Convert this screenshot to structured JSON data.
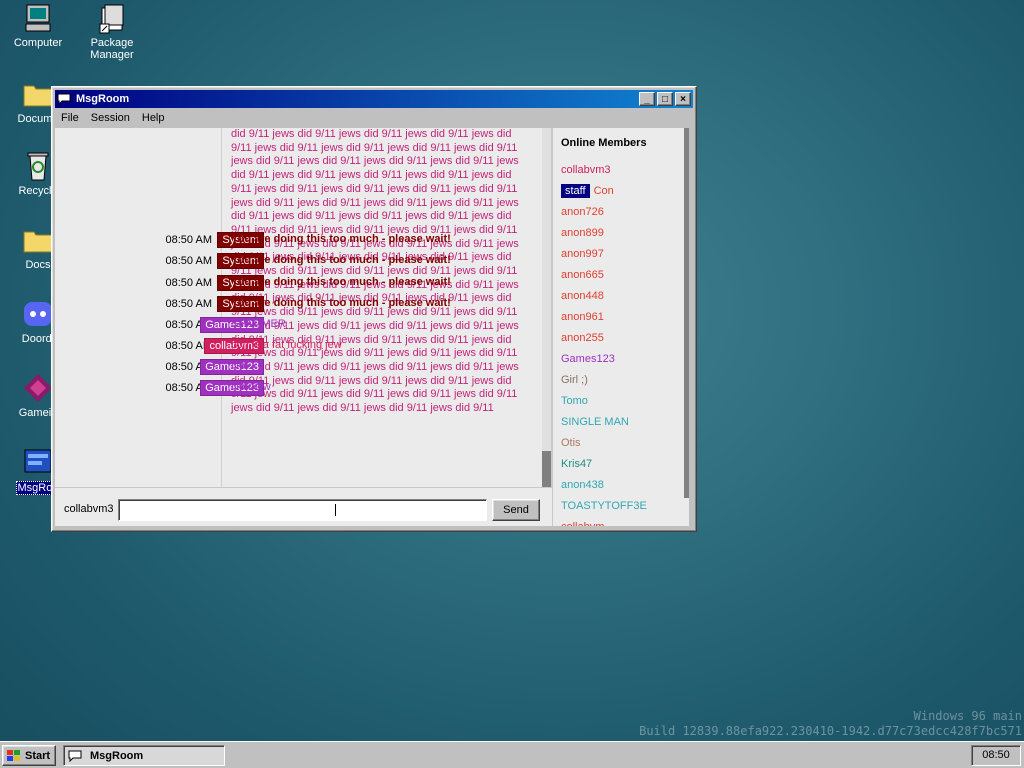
{
  "desktop": {
    "icons": [
      {
        "label": "Computer"
      },
      {
        "label": "Package Manager"
      },
      {
        "label": "Docume"
      },
      {
        "label": "Recycle"
      },
      {
        "label": "Docs"
      },
      {
        "label": "Doordi"
      },
      {
        "label": "Gamein"
      },
      {
        "label": "MsgRoo"
      }
    ],
    "watermark": {
      "line1": "Windows 96 main",
      "line2": "Build 12839.88efa922.230410-1942.d77c73edcc428f7bc571"
    }
  },
  "window": {
    "title": "MsgRoom",
    "menu": [
      "File",
      "Session",
      "Help"
    ],
    "spam_text": "did 9/11 jews did 9/11 jews did 9/11 jews did 9/11 jews did 9/11 jews did 9/11 jews did 9/11 jews did 9/11 jews did 9/11 jews did 9/11 jews did 9/11 jews did 9/11 jews did 9/11 jews did 9/11 jews did 9/11 jews did 9/11 jews did 9/11 jews did 9/11 jews did 9/11 jews did 9/11 jews did 9/11 jews did 9/11 jews did 9/11 jews did 9/11 jews did 9/11 jews did 9/11 jews did 9/11 jews did 9/11 jews did 9/11 jews did 9/11 jews did 9/11 jews did 9/11 jews did 9/11 jews did 9/11 jews did 9/11 jews did 9/11 jews did 9/11 jews did 9/11 jews did 9/11 jews did 9/11 jews did 9/11 jews did 9/11 jews did 9/11 jews did 9/11 jews did 9/11 jews did 9/11 jews did 9/11 jews did 9/11 jews did 9/11 jews did 9/11 jews did 9/11 jews did 9/11 jews did 9/11 jews did 9/11 jews did 9/11 jews did 9/11 jews did 9/11 jews did 9/11 jews did 9/11 jews did 9/11 jews did 9/11 jews did 9/11 jews did 9/11 jews did 9/11 jews did 9/11 jews did 9/11 jews did 9/11 jews did 9/11 jews did 9/11 jews did 9/11 jews did 9/11 jews did 9/11 jews did 9/11 jews did 9/11 jews did 9/11 jews did 9/11 jews did 9/11 jews did 9/11 jews did 9/11 jews did 9/11 jews did 9/11 jews did 9/11 jews did 9/11 jews did 9/11 jews did 9/11 jews did 9/11 jews did 9/11 jews did 9/11 jews did 9/11 jews did 9/11 jews did 9/11",
    "messages": [
      {
        "time": "08:50 AM",
        "user": "System",
        "color": "#800000",
        "text": "You are doing this too much - please wait!",
        "bold": true
      },
      {
        "time": "08:50 AM",
        "user": "System",
        "color": "#800000",
        "text": "You are doing this too much - please wait!",
        "bold": true
      },
      {
        "time": "08:50 AM",
        "user": "System",
        "color": "#800000",
        "text": "You are doing this too much - please wait!",
        "bold": true
      },
      {
        "time": "08:50 AM",
        "user": "System",
        "color": "#800000",
        "text": "You are doing this too much - please wait!",
        "bold": true
      },
      {
        "time": "08:50 AM",
        "user": "Games123",
        "color": "#a030c0",
        "text": "SPAMMER",
        "bold": false
      },
      {
        "time": "08:50 AM",
        "user": "collabvm3",
        "color": "#d02060",
        "text": "con is a fat fucking jew",
        "bold": false
      },
      {
        "time": "08:50 AM",
        "user": "Games123",
        "color": "#a030c0",
        "text": "No",
        "bold": false
      },
      {
        "time": "08:50 AM",
        "user": "Games123",
        "color": "#a030c0",
        "text": "No nsfw",
        "bold": false
      }
    ],
    "input": {
      "nick": "collabvm3",
      "value": "",
      "send_label": "Send"
    },
    "members": {
      "title": "Online Members",
      "staff_badge": "staff",
      "list": [
        {
          "name": "collabvm3",
          "color": "#d02060",
          "staff": false
        },
        {
          "name": "Con",
          "color": "#e04030",
          "staff": true
        },
        {
          "name": "anon726",
          "color": "#e04030",
          "staff": false
        },
        {
          "name": "anon899",
          "color": "#e04030",
          "staff": false
        },
        {
          "name": "anon997",
          "color": "#e04030",
          "staff": false
        },
        {
          "name": "anon665",
          "color": "#e04030",
          "staff": false
        },
        {
          "name": "anon448",
          "color": "#e04030",
          "staff": false
        },
        {
          "name": "anon961",
          "color": "#e04030",
          "staff": false
        },
        {
          "name": "anon255",
          "color": "#e04030",
          "staff": false
        },
        {
          "name": "Games123",
          "color": "#a030c0",
          "staff": false
        },
        {
          "name": "Girl ;)",
          "color": "#8a7060",
          "staff": false
        },
        {
          "name": "Tomo",
          "color": "#30a8b0",
          "staff": false
        },
        {
          "name": "SINGLE MAN",
          "color": "#30a8b0",
          "staff": false
        },
        {
          "name": "Otis",
          "color": "#b07860",
          "staff": false
        },
        {
          "name": "Kris47",
          "color": "#209080",
          "staff": false
        },
        {
          "name": "anon438",
          "color": "#30a8b0",
          "staff": false
        },
        {
          "name": "TOASTYTOFF3E",
          "color": "#30a8b0",
          "staff": false
        },
        {
          "name": "collabvm",
          "color": "#e04030",
          "staff": false
        }
      ]
    }
  },
  "taskbar": {
    "start_label": "Start",
    "task_label": "MsgRoom",
    "clock": "08:50"
  }
}
